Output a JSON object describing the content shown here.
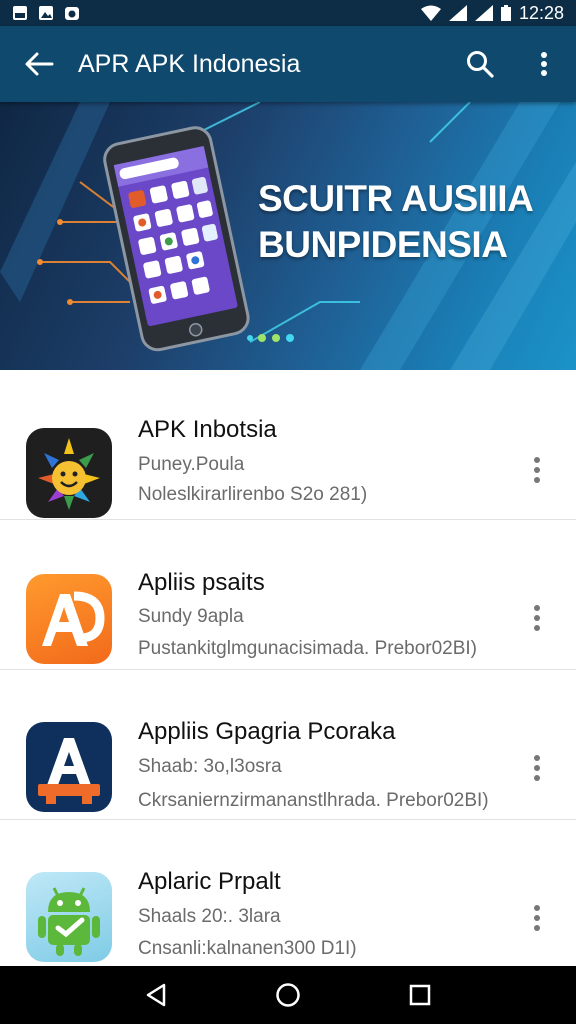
{
  "status_bar": {
    "time": "12:28"
  },
  "app_bar": {
    "title": "APR APK Indonesia"
  },
  "banner": {
    "line1": "SCUITR AUSIIIA",
    "line2": "BUNPIDENSIA"
  },
  "apps": [
    {
      "name": "APK Inbotsia",
      "line1": "Puney.Poula",
      "line2": "Noleslkirarlirenbo  S2o 281)"
    },
    {
      "name": "Apliis psaits",
      "line1": "Sundy 9apla",
      "line2": "Pustankitglmgunacisimada. Prebor02BI)"
    },
    {
      "name": "Appliis Gpagria Pcoraka",
      "line1": "Shaab: 3o,l3osra",
      "line2": "Ckrsaniernzirmananstlhrada. Prebor02BI)"
    },
    {
      "name": "Aplaric Prpalt",
      "line1": "Shaals 20:. 3lara",
      "line2": "Cnsanli:kalnanen300 D1I)"
    }
  ],
  "colors": {
    "appbar": "#0f4a6e",
    "statusbar": "#0c2d45",
    "accent": "#1b93c8"
  }
}
